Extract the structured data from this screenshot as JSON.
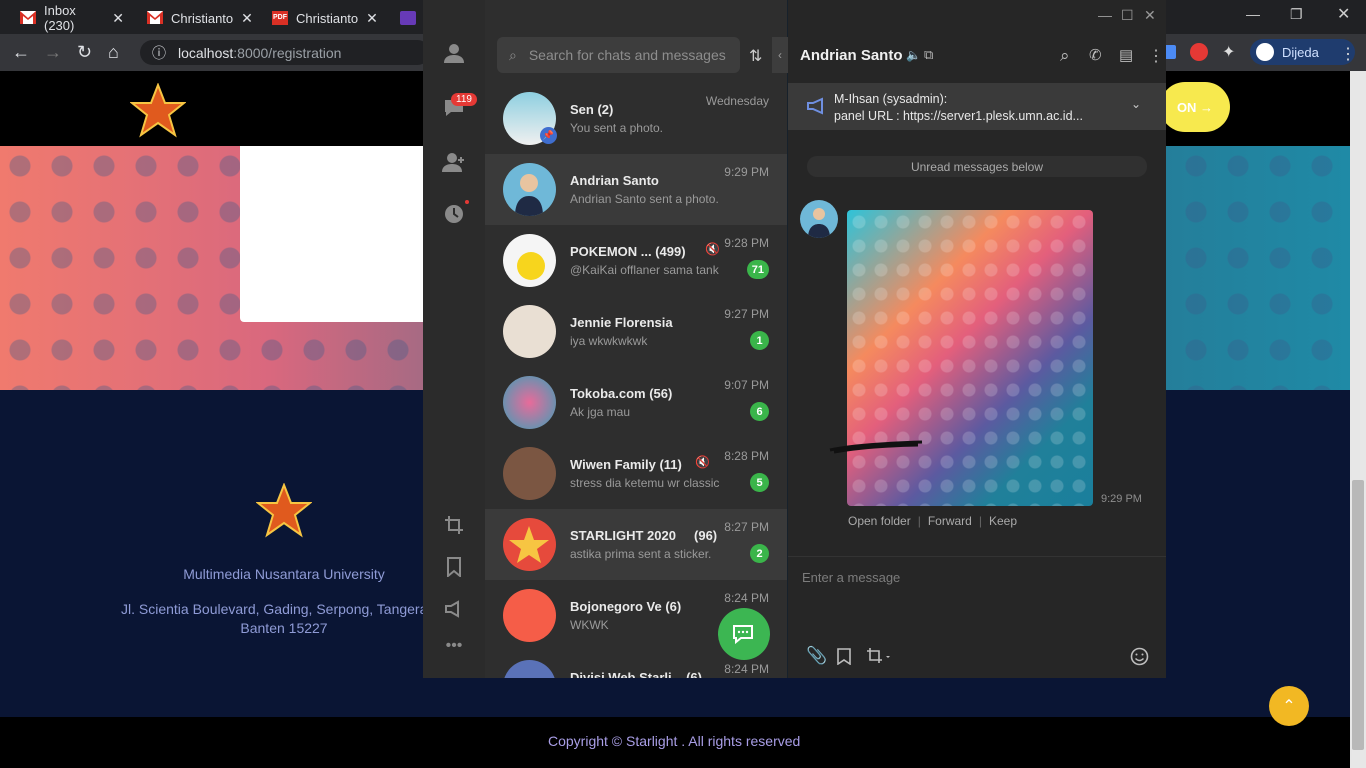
{
  "browser": {
    "tabs": [
      {
        "label": "Inbox (230)",
        "icon": "gmail-icon"
      },
      {
        "label": "Christianto",
        "icon": "gmail-icon"
      },
      {
        "label": "Christianto",
        "icon": "pdf-icon"
      }
    ],
    "url_host": "localhost",
    "url_path": ":8000/registration",
    "profile_name": "Dijeda"
  },
  "website": {
    "signup_label": "ON",
    "university": "Multimedia Nusantara University",
    "address_line1": "Jl. Scientia Boulevard, Gading, Serpong, Tangera",
    "address_line2": "Banten 15227",
    "copyright": "Copyright © Starlight . All rights reserved",
    "logo_text": "Starlight"
  },
  "telegram": {
    "sidebar_badge": "119",
    "search_placeholder": "Search for chats and messages",
    "chats": [
      {
        "name": "Sen (2)",
        "preview": "You sent a photo.",
        "time": "Wednesday",
        "unread": "",
        "muted": false,
        "avatar_color": "#8ecfe0"
      },
      {
        "name": "Andrian Santo",
        "preview": "Andrian Santo sent a photo.",
        "time": "9:29 PM",
        "unread": "",
        "muted": false,
        "avatar_color": "#6fb8d8"
      },
      {
        "name": "POKEMON ... (499)",
        "preview": "@KaiKai offlaner sama tank",
        "time": "9:28 PM",
        "unread": "71",
        "muted": true,
        "avatar_color": "#f5f5f5"
      },
      {
        "name": "Jennie Florensia",
        "preview": "iya wkwkwkwk",
        "time": "9:27 PM",
        "unread": "1",
        "muted": false,
        "avatar_color": "#e9dfd3"
      },
      {
        "name": "Tokoba.com (56)",
        "preview": "Ak jga mau",
        "time": "9:07 PM",
        "unread": "6",
        "muted": false,
        "avatar_color": "#3aa0b8"
      },
      {
        "name": "Wiwen Family (11)",
        "preview": "stress dia ketemu wr classic",
        "time": "8:28 PM",
        "unread": "5",
        "muted": true,
        "avatar_color": "#7b5642"
      },
      {
        "name": "STARLIGHT 2020     (96)",
        "preview": "astika prima sent a sticker.",
        "time": "8:27 PM",
        "unread": "2",
        "muted": false,
        "avatar_color": "#e64a3c"
      },
      {
        "name": "Bojonegoro Ve (6)",
        "preview": "WKWK",
        "time": "8:24 PM",
        "unread": "",
        "muted": false,
        "avatar_color": "#f55d48"
      },
      {
        "name": "Divisi Web Starli... (6)",
        "preview": "",
        "time": "8:24 PM",
        "unread": "",
        "muted": false,
        "avatar_color": "#5a72b8"
      }
    ],
    "active_chat": {
      "title": "Andrian Santo",
      "pinned_line1": "M-Ihsan (sysadmin):",
      "pinned_line2": "panel URL : https://server1.plesk.umn.ac.id...",
      "unread_divider": "Unread messages below",
      "photo_time": "9:29 PM",
      "actions": [
        "Open folder",
        "Forward",
        "Keep"
      ],
      "input_placeholder": "Enter a message"
    }
  }
}
